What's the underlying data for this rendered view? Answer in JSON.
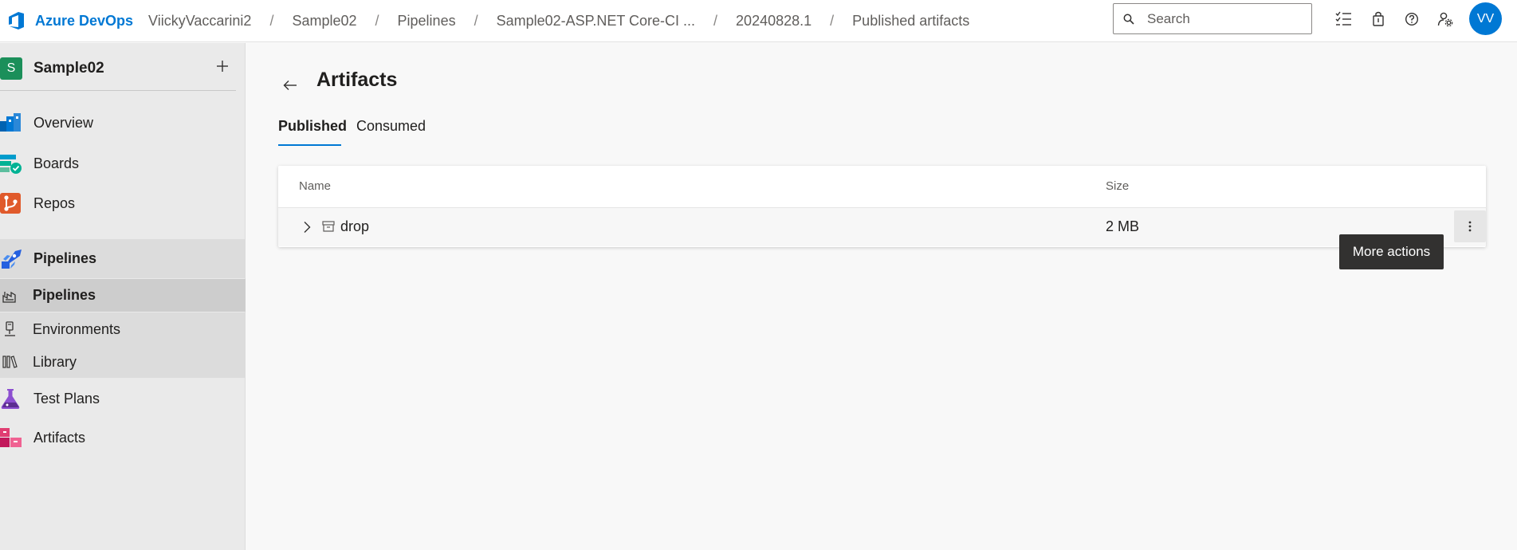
{
  "header": {
    "brand": "Azure DevOps",
    "breadcrumbs": [
      "ViickyVaccarini2",
      "Sample02",
      "Pipelines",
      "Sample02-ASP.NET Core-CI ...",
      "20240828.1",
      "Published artifacts"
    ],
    "breadcrumb_separator": "/",
    "search_placeholder": "Search",
    "avatar_initials": "VV",
    "icons": [
      "task-list-icon",
      "shopping-bag-icon",
      "help-icon",
      "user-settings-icon"
    ]
  },
  "sidebar": {
    "project_initial": "S",
    "project_name": "Sample02",
    "items": [
      {
        "label": "Overview",
        "icon": "overview-icon"
      },
      {
        "label": "Boards",
        "icon": "boards-icon"
      },
      {
        "label": "Repos",
        "icon": "repos-icon"
      },
      {
        "label": "Pipelines",
        "icon": "pipelines-icon"
      },
      {
        "label": "Pipelines",
        "icon": "pipelines-sub-icon"
      },
      {
        "label": "Environments",
        "icon": "environments-icon"
      },
      {
        "label": "Library",
        "icon": "library-icon"
      },
      {
        "label": "Test Plans",
        "icon": "test-plans-icon"
      },
      {
        "label": "Artifacts",
        "icon": "artifacts-icon"
      }
    ]
  },
  "main": {
    "title": "Artifacts",
    "tabs": [
      {
        "label": "Published",
        "selected": true
      },
      {
        "label": "Consumed",
        "selected": false
      }
    ],
    "table": {
      "columns": [
        "Name",
        "Size"
      ],
      "rows": [
        {
          "name": "drop",
          "size": "2 MB"
        }
      ]
    },
    "tooltip": "More actions"
  },
  "colors": {
    "accent": "#0078d4",
    "project_avatar": "#1b8f5a",
    "tooltip_bg": "#323130"
  }
}
